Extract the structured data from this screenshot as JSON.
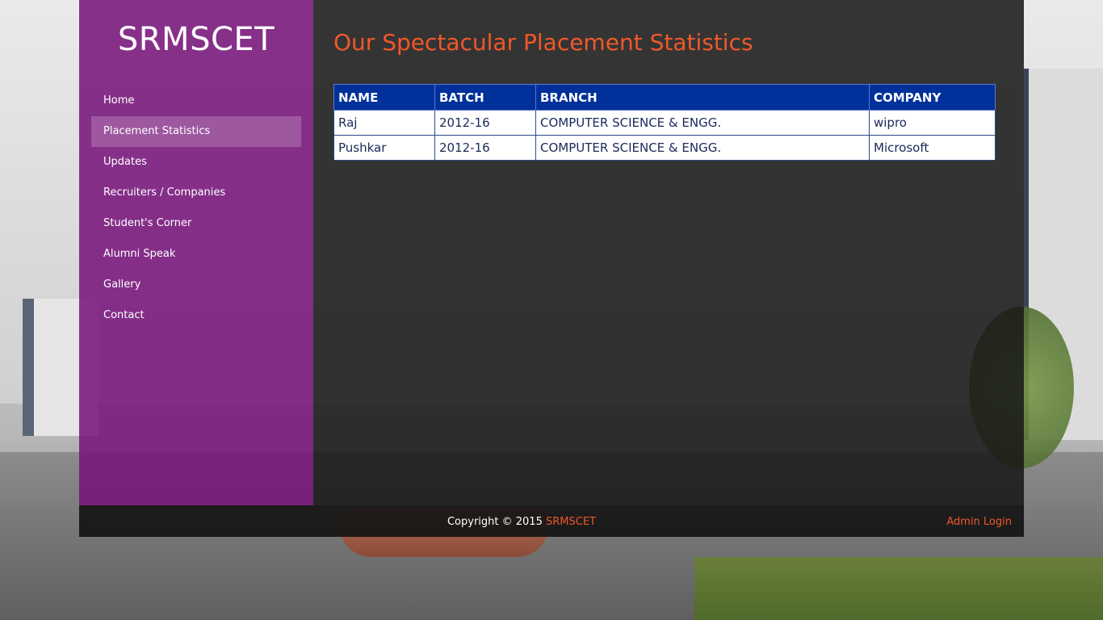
{
  "site": {
    "logo": "SRMSCET"
  },
  "sidebar": {
    "items": [
      {
        "label": "Home"
      },
      {
        "label": "Placement Statistics",
        "active": true
      },
      {
        "label": "Updates"
      },
      {
        "label": "Recruiters / Companies"
      },
      {
        "label": "Student's Corner"
      },
      {
        "label": "Alumni Speak"
      },
      {
        "label": "Gallery"
      },
      {
        "label": "Contact"
      }
    ]
  },
  "main": {
    "title": "Our Spectacular Placement Statistics",
    "table": {
      "headers": [
        "NAME",
        "BATCH",
        "BRANCH",
        "COMPANY"
      ],
      "rows": [
        [
          "Raj",
          "2012-16",
          "COMPUTER SCIENCE & ENGG.",
          "wipro"
        ],
        [
          "Pushkar",
          "2012-16",
          "COMPUTER SCIENCE & ENGG.",
          "Microsoft"
        ]
      ]
    }
  },
  "footer": {
    "copyright_prefix": "Copyright © 2015 ",
    "copyright_link": "SRMSCET",
    "admin_login": "Admin Login"
  },
  "colors": {
    "sidebar": "#76117a",
    "accent": "#f0582a",
    "table_header": "#00309a"
  }
}
